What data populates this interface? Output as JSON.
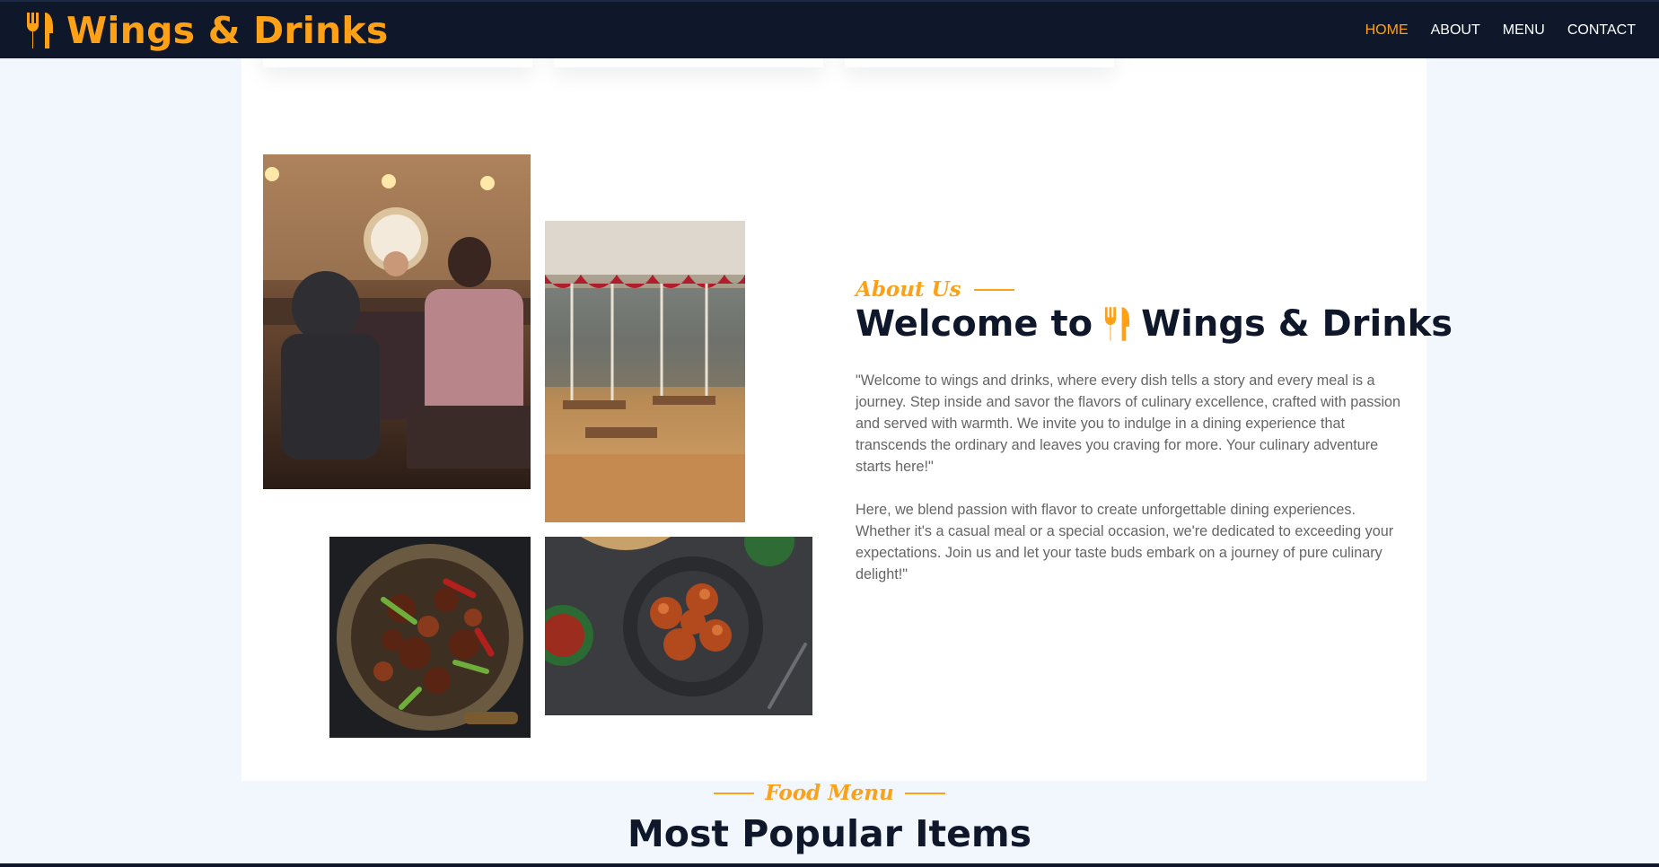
{
  "brand": {
    "name": "Wings & Drinks",
    "icon": "utensils-icon",
    "color": "#fea116"
  },
  "nav": {
    "items": [
      {
        "label": "HOME",
        "active": true
      },
      {
        "label": "ABOUT",
        "active": false
      },
      {
        "label": "MENU",
        "active": false
      },
      {
        "label": "CONTACT",
        "active": false
      }
    ]
  },
  "about": {
    "kicker": "About Us",
    "title_prefix": "Welcome to",
    "title_brand": "Wings & Drinks",
    "paragraphs": [
      "\"Welcome to wings and drinks, where every dish tells a story and every meal is a journey. Step inside and savor the flavors of culinary excellence, crafted with passion and served with warmth. We invite you to indulge in a dining experience that transcends the ordinary and leaves you craving for more. Your culinary adventure starts here!\"",
      "Here, we blend passion with flavor to create unforgettable dining experiences. Whether it's a casual meal or a special occasion, we're dedicated to exceeding your expectations. Join us and let your taste buds embark on a journey of pure culinary delight!\""
    ],
    "images": [
      {
        "alt": "restaurant-bar-photo"
      },
      {
        "alt": "dining-hall-photo"
      },
      {
        "alt": "chilli-chicken-photo"
      },
      {
        "alt": "momo-dish-photo"
      }
    ]
  },
  "menu": {
    "kicker": "Food Menu",
    "title": "Most Popular Items"
  },
  "colors": {
    "primary": "#fea116",
    "dark": "#0f172b",
    "light": "#f1f7fd",
    "text": "#666565"
  }
}
